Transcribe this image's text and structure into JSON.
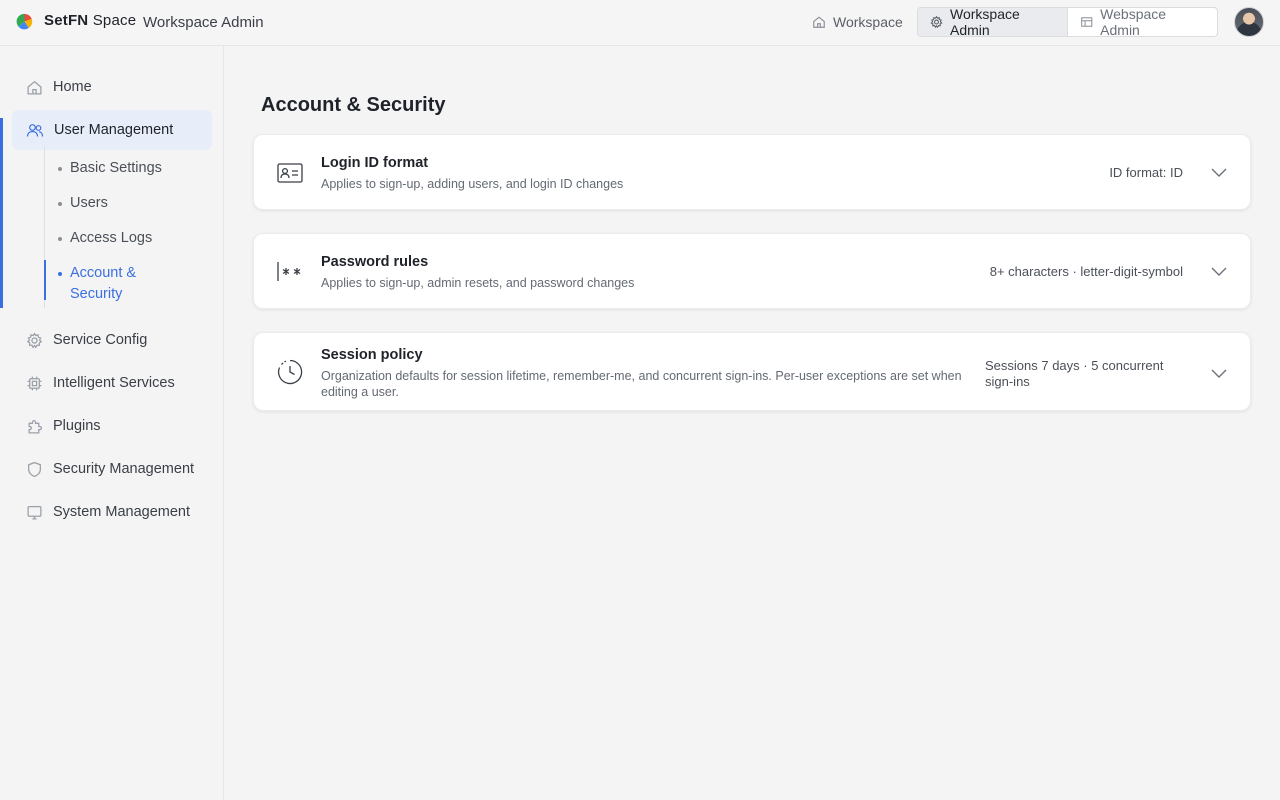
{
  "header": {
    "brand_bold": "SetFN",
    "brand_rest": "Space",
    "app_name": "Workspace Admin",
    "nav_workspace": "Workspace",
    "nav_workspace_admin": "Workspace Admin",
    "nav_webspace_admin": "Webspace Admin"
  },
  "sidebar": {
    "home": "Home",
    "user_management": "User Management",
    "sub_items": [
      "Basic Settings",
      "Users",
      "Access Logs",
      "Account & Security"
    ],
    "service_config": "Service Config",
    "intelligent_services": "Intelligent Services",
    "plugins": "Plugins",
    "security_management": "Security Management",
    "system_management": "System Management"
  },
  "main": {
    "title": "Account & Security",
    "cards": [
      {
        "title": "Login ID format",
        "desc": "Applies to sign-up, adding users, and login ID changes",
        "value": "ID format: ID"
      },
      {
        "title": "Password rules",
        "desc": "Applies to sign-up, admin resets, and password changes",
        "value": "8+ characters · letter-digit-symbol"
      },
      {
        "title": "Session policy",
        "desc": "Organization defaults for session lifetime, remember-me, and concurrent sign-ins. Per-user exceptions are set when editing a user.",
        "value": "Sessions 7 days · 5 concurrent sign-ins"
      }
    ]
  },
  "colors": {
    "accent": "#3b6fe0",
    "active_bg": "#e8eef9"
  }
}
